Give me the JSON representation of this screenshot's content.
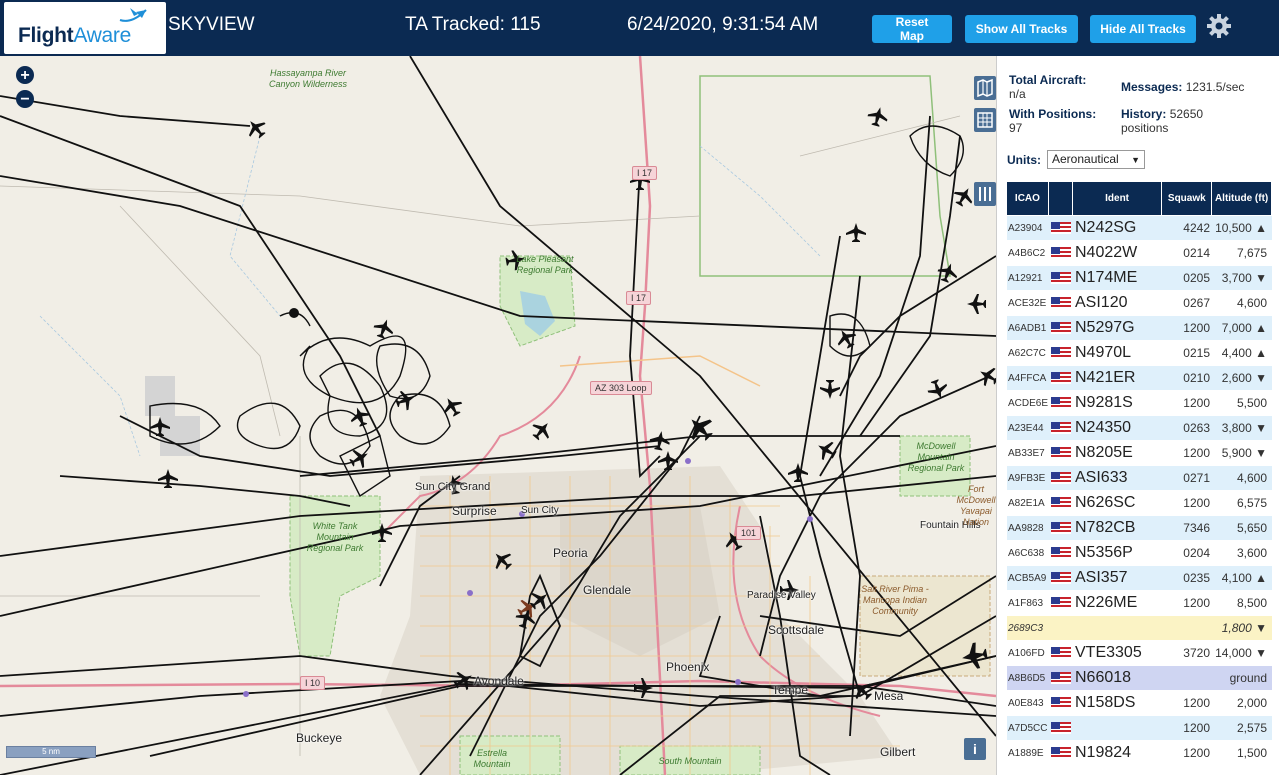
{
  "header": {
    "logo_text_main": "Flight",
    "logo_text_accent": "Aware",
    "site_name": "SKYVIEW",
    "tracked": "TA Tracked: 115",
    "datetime": "6/24/2020, 9:31:54 AM",
    "buttons": {
      "reset": "Reset Map",
      "show_all": "Show All Tracks",
      "hide_all": "Hide All Tracks"
    },
    "colors": {
      "bar": "#0b2a52",
      "button": "#1fa0e8"
    }
  },
  "map": {
    "zoom_in": "+",
    "zoom_out": "−",
    "scale": "5 nm",
    "info": "i",
    "roads": [
      "I 17",
      "I 17",
      "AZ 303 Loop",
      "I 10",
      "101"
    ],
    "parks": [
      "Hassayampa River Canyon Wilderness",
      "Lake Pleasant Regional Park",
      "White Tank Mountain Regional Park",
      "McDowell Mountain Regional Park",
      "Salt River Pima - Maricopa Indian Community",
      "Estrella Mountain",
      "South Mountain"
    ],
    "cities": [
      "Sun City Grand",
      "Surprise",
      "Sun City",
      "Peoria",
      "Glendale",
      "Phoenix",
      "Avondale",
      "Paradise Valley",
      "Scottsdale",
      "Tempe",
      "Fountain Hills",
      "Buckeye",
      "Gilbert",
      "Fort McDowell Yavapai Nation",
      "Mesa"
    ],
    "colors": {
      "land": "#f1eee6",
      "park": "#d7ebc6",
      "urban": "#e2ddd3",
      "track": "#111111"
    }
  },
  "panel": {
    "total_label": "Total Aircraft:",
    "total_value": "n/a",
    "messages_label": "Messages:",
    "messages_value": "1231.5/sec",
    "positions_label": "With Positions:",
    "positions_value": "97",
    "history_label": "History:",
    "history_value": "52650",
    "history_unit": "positions",
    "units_label": "Units:",
    "units_value": "Aeronautical",
    "columns": [
      "ICAO",
      "",
      "Ident",
      "Squawk",
      "Altitude (ft)"
    ],
    "rows": [
      {
        "icao": "A23904",
        "ident": "N242SG",
        "squawk": "4242",
        "alt": "10,500 ▲"
      },
      {
        "icao": "A4B6C2",
        "ident": "N4022W",
        "squawk": "0214",
        "alt": "7,675"
      },
      {
        "icao": "A12921",
        "ident": "N174ME",
        "squawk": "0205",
        "alt": "3,700 ▼"
      },
      {
        "icao": "ACE32E",
        "ident": "ASI120",
        "squawk": "0267",
        "alt": "4,600"
      },
      {
        "icao": "A6ADB1",
        "ident": "N5297G",
        "squawk": "1200",
        "alt": "7,000 ▲"
      },
      {
        "icao": "A62C7C",
        "ident": "N4970L",
        "squawk": "0215",
        "alt": "4,400 ▲"
      },
      {
        "icao": "A4FFCA",
        "ident": "N421ER",
        "squawk": "0210",
        "alt": "2,600 ▼"
      },
      {
        "icao": "ACDE6E",
        "ident": "N9281S",
        "squawk": "1200",
        "alt": "5,500"
      },
      {
        "icao": "A23E44",
        "ident": "N24350",
        "squawk": "0263",
        "alt": "3,800 ▼"
      },
      {
        "icao": "AB33E7",
        "ident": "N8205E",
        "squawk": "1200",
        "alt": "5,900 ▼"
      },
      {
        "icao": "A9FB3E",
        "ident": "ASI633",
        "squawk": "0271",
        "alt": "4,600"
      },
      {
        "icao": "A82E1A",
        "ident": "N626SC",
        "squawk": "1200",
        "alt": "6,575"
      },
      {
        "icao": "AA9828",
        "ident": "N782CB",
        "squawk": "7346",
        "alt": "5,650"
      },
      {
        "icao": "A6C638",
        "ident": "N5356P",
        "squawk": "0204",
        "alt": "3,600"
      },
      {
        "icao": "ACB5A9",
        "ident": "ASI357",
        "squawk": "0235",
        "alt": "4,100 ▲"
      },
      {
        "icao": "A1F863",
        "ident": "N226ME",
        "squawk": "1200",
        "alt": "8,500"
      },
      {
        "icao": "2689C3",
        "ident": "",
        "squawk": "",
        "alt": "1,800 ▼"
      },
      {
        "icao": "A106FD",
        "ident": "VTE3305",
        "squawk": "3720",
        "alt": "14,000 ▼"
      },
      {
        "icao": "A8B6D5",
        "ident": "N66018",
        "squawk": "",
        "alt": "ground"
      },
      {
        "icao": "A0E843",
        "ident": "N158DS",
        "squawk": "1200",
        "alt": "2,000"
      },
      {
        "icao": "A7D5CC",
        "ident": "",
        "squawk": "1200",
        "alt": "2,575"
      },
      {
        "icao": "A1889E",
        "ident": "N19824",
        "squawk": "1200",
        "alt": "1,500"
      }
    ]
  }
}
